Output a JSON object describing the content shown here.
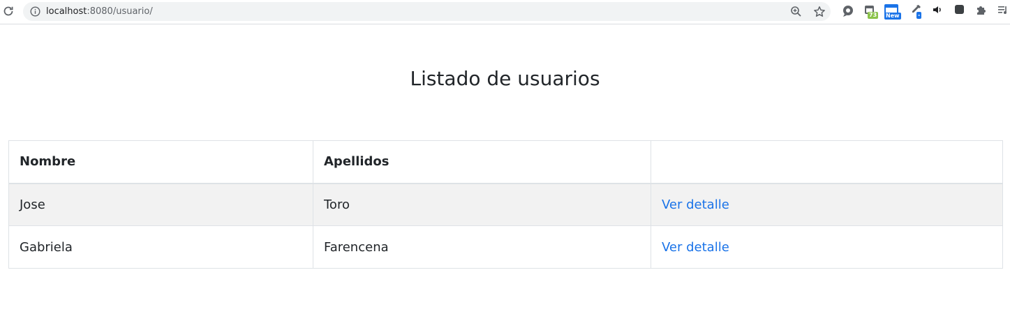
{
  "browser": {
    "url_host": "localhost",
    "url_rest": ":8080/usuario/",
    "extensions": [
      {
        "icon": "speech-bubble-extension-icon"
      },
      {
        "icon": "calendar-extension-icon",
        "badge": "73",
        "badge_color": "#8bc34a"
      },
      {
        "icon": "window-extension-icon",
        "badge": "New",
        "badge_color": "#1a73e8"
      },
      {
        "icon": "eyedropper-extension-icon",
        "badge": "-",
        "badge_color": "#1a73e8"
      },
      {
        "icon": "speaker-icon"
      },
      {
        "icon": "square-extension-icon"
      },
      {
        "icon": "puzzle-icon"
      },
      {
        "icon": "media-queue-icon"
      }
    ]
  },
  "page": {
    "title": "Listado de usuarios"
  },
  "table": {
    "headers": [
      "Nombre",
      "Apellidos",
      ""
    ],
    "rows": [
      {
        "nombre": "Jose",
        "apellidos": "Toro",
        "link": "Ver detalle"
      },
      {
        "nombre": "Gabriela",
        "apellidos": "Farencena",
        "link": "Ver detalle"
      }
    ]
  },
  "colors": {
    "link": "#1a73e8",
    "stripe": "#f2f2f2",
    "border": "#dee2e6"
  }
}
